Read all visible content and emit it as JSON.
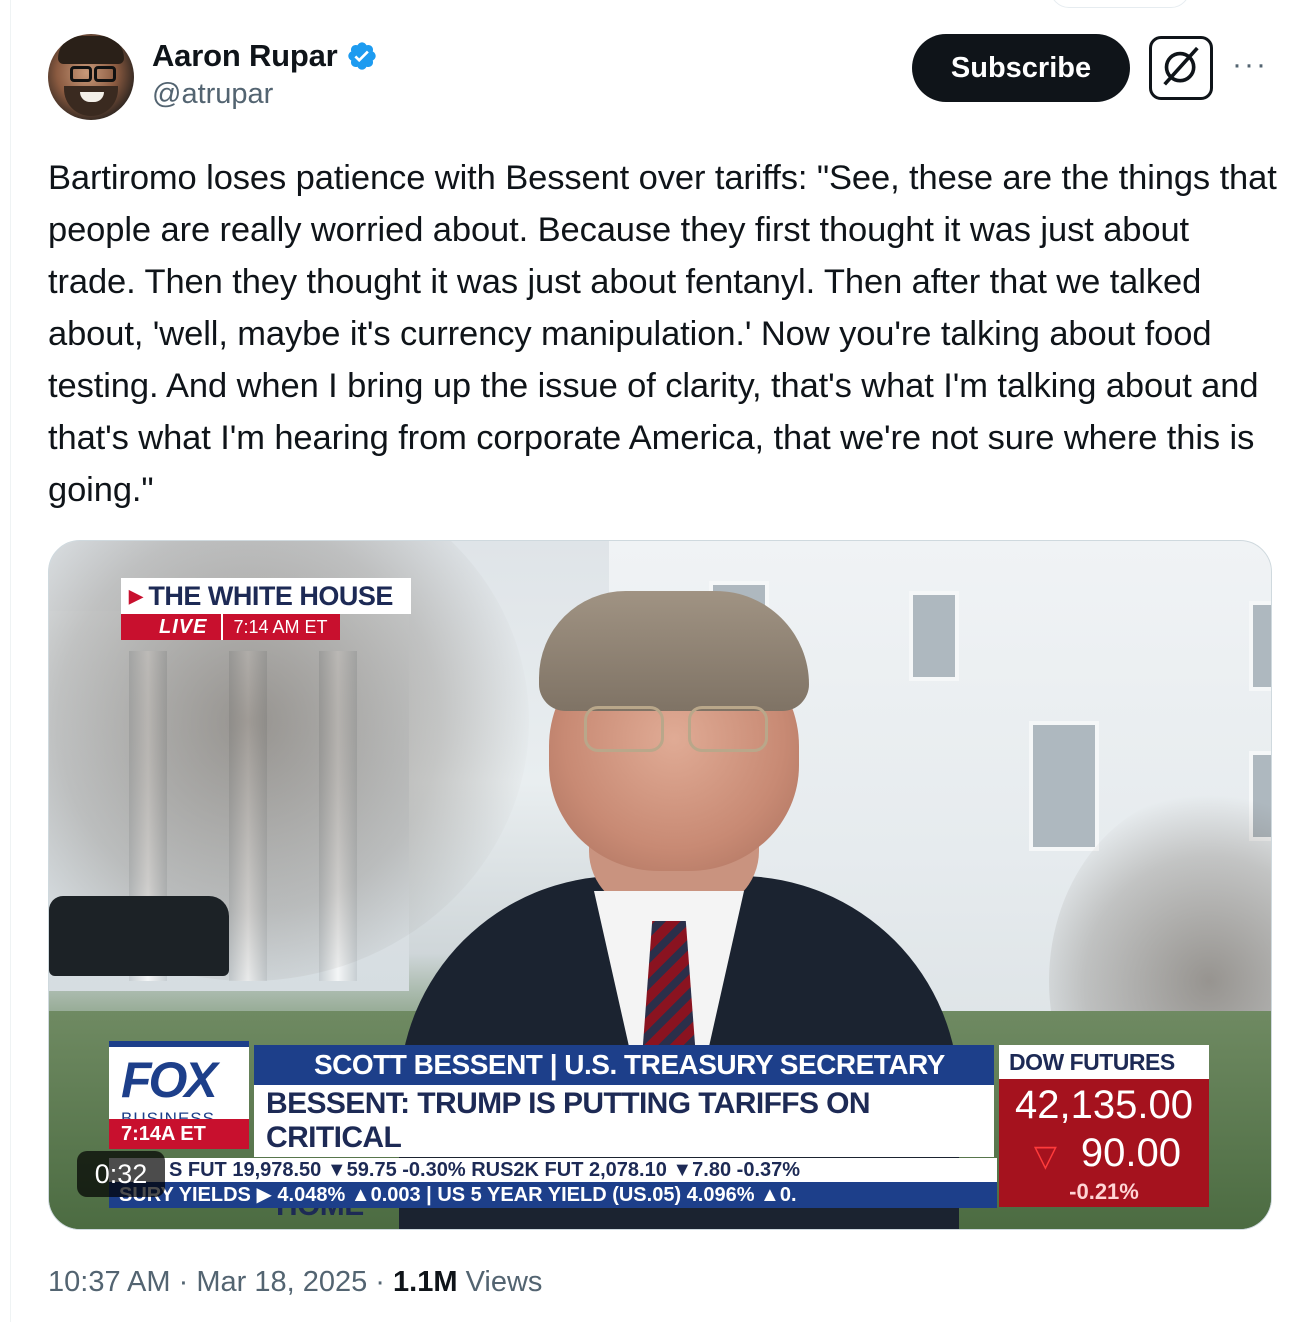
{
  "author": {
    "display_name": "Aaron Rupar",
    "handle": "@atrupar",
    "verified": true
  },
  "actions": {
    "subscribe_label": "Subscribe",
    "grok_icon": "grok-icon",
    "more_label": "···"
  },
  "tweet": {
    "text": "Bartiromo loses patience with Bessent over tariffs: \"See, these are the things that people are really worried about. Because they first thought it was just about trade. Then they thought it was just about fentanyl. Then after that we talked about, 'well, maybe it's currency manipulation.' Now you're talking about food testing. And when I bring up the issue of clarity, that's what I'm talking about and that's what I'm hearing from corporate America, that we're not sure where this is going.\""
  },
  "video": {
    "elapsed": "0:32",
    "location_label": "THE WHITE HOUSE",
    "live_label": "LIVE",
    "live_time": "7:14 AM ET",
    "network": "FOX",
    "network_sub": "BUSINESS",
    "network_time": "7:14A ET",
    "name_bar": "SCOTT BESSENT | U.S. TREASURY SECRETARY",
    "headline_line1": "BESSENT: TRUMP IS PUTTING TARIFFS ON CRITICAL",
    "headline_line2": "INDUSTRIES TO BRING PRODUCTION BACK HOME",
    "dow_label": "DOW FUTURES",
    "dow_value": "42,135.00",
    "dow_change": "90.00",
    "dow_pct": "-0.21%",
    "ticker1": "S FUT  19,978.50 ▼59.75  -0.30%  RUS2K FUT  2,078.10 ▼7.80  -0.37%",
    "ticker2": "SURY YIELDS ▶ 4.048% ▲0.003  |  US 5 YEAR YIELD (US.05)  4.096% ▲0."
  },
  "meta": {
    "time": "10:37 AM",
    "date": "Mar 18, 2025",
    "views_count": "1.1M",
    "views_label": "Views",
    "separator": "·"
  },
  "colors": {
    "brand_dark": "#0f1419",
    "secondary_text": "#536471",
    "verified_blue": "#1d9bf0",
    "fox_blue": "#1d3f8a",
    "fox_red": "#c8102e"
  }
}
